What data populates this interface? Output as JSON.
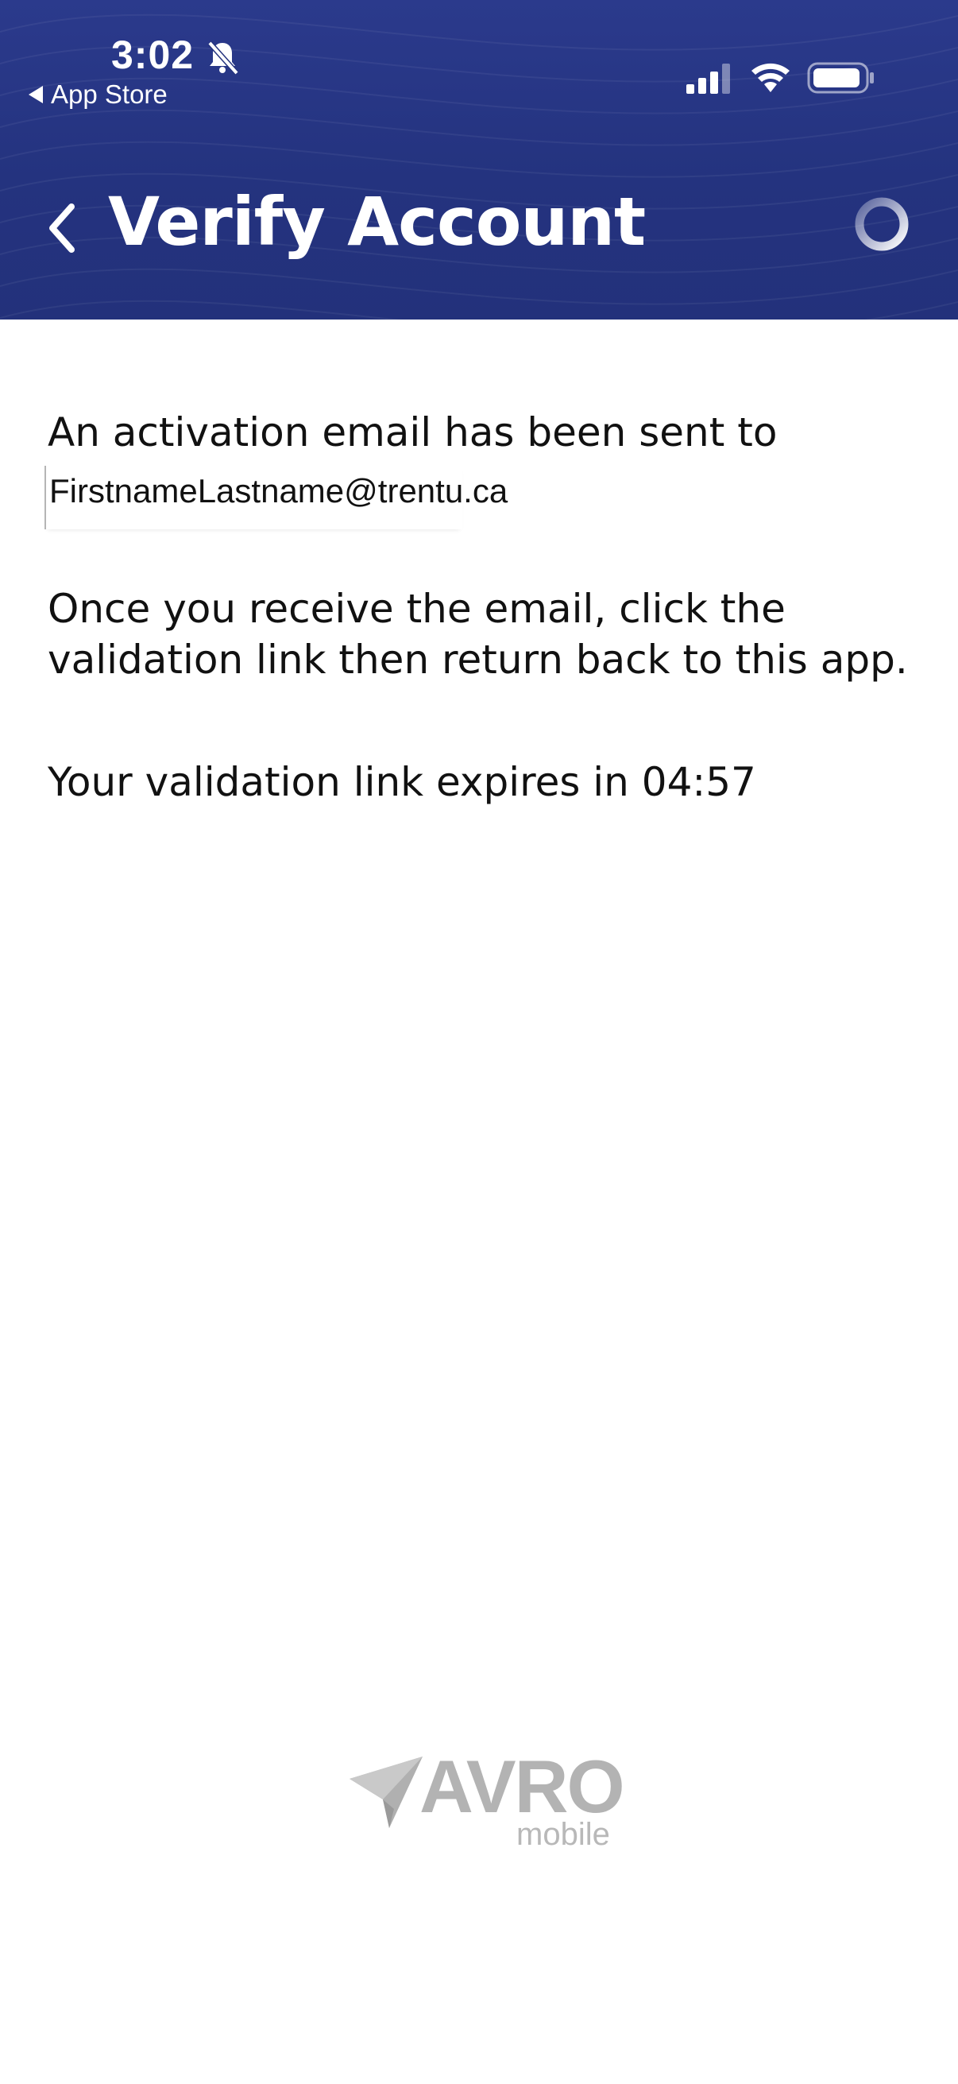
{
  "status_bar": {
    "time": "3:02",
    "back_app_label": "App Store",
    "icons": [
      "bell-slash-icon",
      "signal-icon",
      "wifi-icon",
      "battery-icon"
    ]
  },
  "header": {
    "title": "Verify Account",
    "back_icon": "chevron-left-icon",
    "status_icon": "loading-spinner-icon",
    "background_color": "#25347f"
  },
  "content": {
    "line1": "An activation email has been sent to",
    "email": "FirstnameLastname@trentu.ca",
    "instructions": "Once you receive the email, click the validation link then return back to this app.",
    "expiry": "Your validation link expires in 04:57"
  },
  "footer_logo": {
    "brand": "AVRO",
    "sub": "mobile",
    "icon": "paper-plane-icon"
  }
}
